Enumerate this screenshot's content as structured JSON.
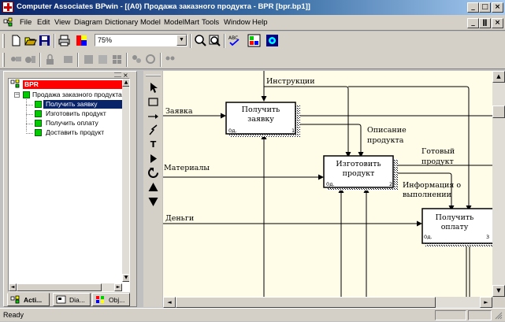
{
  "window": {
    "title": "Computer Associates BPwin - [(A0) Продажа заказного продукта - BPR  [bpr.bp1]]"
  },
  "menu": [
    "File",
    "Edit",
    "View",
    "Diagram",
    "Dictionary",
    "Model",
    "ModelMart",
    "Tools",
    "Window",
    "Help"
  ],
  "toolbar": {
    "zoom_value": "75%"
  },
  "explorer": {
    "root": "BPR",
    "model": "Продажа заказного продукта",
    "activities": [
      "Получить заявку",
      "Изготовить продукт",
      "Получить оплату",
      "Доставить продукт"
    ],
    "selected_index": 0,
    "tabs": [
      "Acti...",
      "Dia...",
      "Obj..."
    ]
  },
  "diagram": {
    "boxes": [
      {
        "name": "Получить заявку",
        "line1": "Получить",
        "line2": "заявку",
        "cost": "0д.",
        "num": "1"
      },
      {
        "name": "Изготовить продукт",
        "line1": "Изготовить",
        "line2": "продукт",
        "cost": "0д.",
        "num": "2"
      },
      {
        "name": "Получить оплату",
        "line1": "Получить",
        "line2": "оплату",
        "cost": "0д.",
        "num": "3"
      }
    ],
    "arrows": {
      "instructions": "Инструкции",
      "request": "Заявка",
      "materials": "Материалы",
      "money": "Деньги",
      "description_1": "Описание",
      "description_2": "продукта",
      "finished_1": "Готовый",
      "finished_2": "продукт",
      "info_1": "Информация о",
      "info_2": "выполнении"
    }
  },
  "status": {
    "text": "Ready"
  },
  "colors": {
    "titlebar_start": "#0a246a",
    "selection": "#0a246a",
    "root_highlight": "#ff0000",
    "canvas": "#fffde8",
    "tree_box": "#00cc00"
  }
}
